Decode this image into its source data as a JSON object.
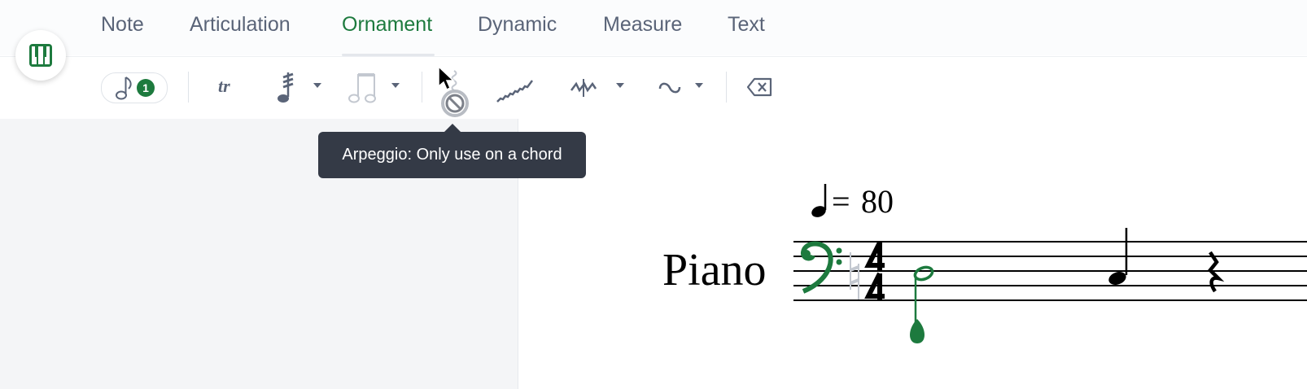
{
  "tabs": [
    {
      "label": "Note"
    },
    {
      "label": "Articulation"
    },
    {
      "label": "Ornament",
      "active": true
    },
    {
      "label": "Dynamic"
    },
    {
      "label": "Measure"
    },
    {
      "label": "Text"
    }
  ],
  "toolbar": {
    "selected_notes_count": "1",
    "trill_label": "tr"
  },
  "tooltip": {
    "text": "Arpeggio: Only use on a chord"
  },
  "score": {
    "instrument": "Piano",
    "tempo_equals": "=",
    "tempo_value": "80"
  },
  "colors": {
    "accent": "#1d7a3e",
    "tab_text": "#5a6478",
    "tooltip_bg": "#343a46"
  },
  "icons": [
    "piano-keyboard-icon",
    "quarter-note-icon",
    "trill-icon",
    "tremolo-icon",
    "beamed-notes-icon",
    "arpeggio-icon",
    "glissando-icon",
    "mordent-icon",
    "turn-icon",
    "delete-icon",
    "not-allowed-icon"
  ]
}
